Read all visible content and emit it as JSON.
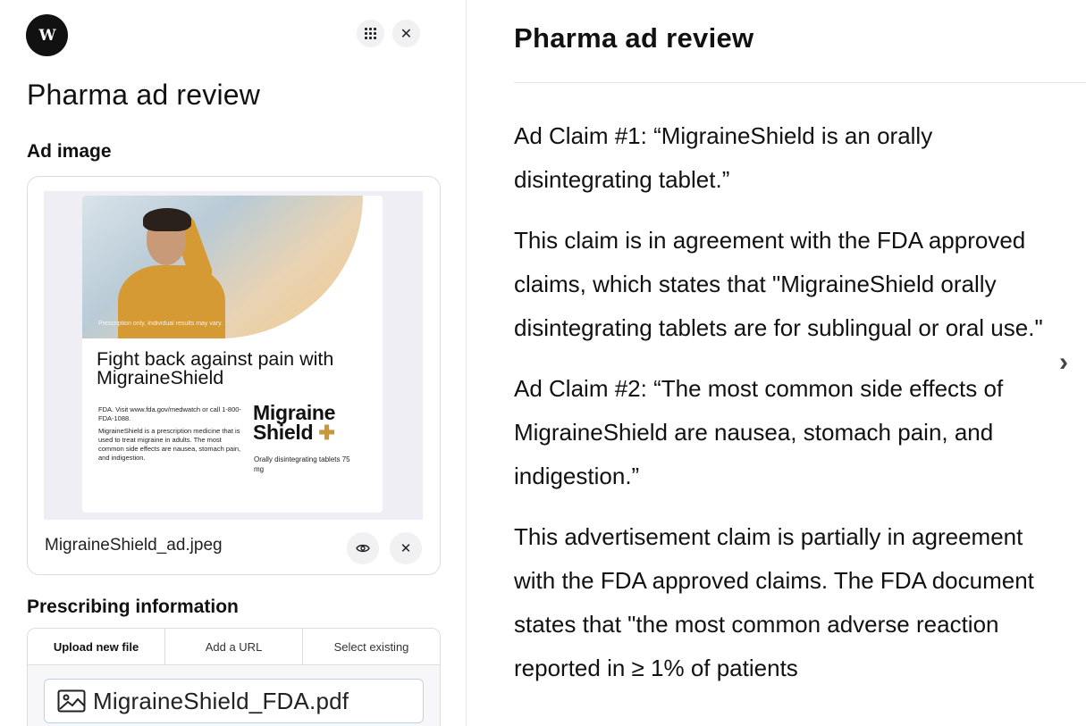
{
  "left_panel": {
    "logo_text": "W",
    "title": "Pharma ad review",
    "ad_image_label": "Ad image",
    "ad": {
      "disclaimer": "Prescription only. Individual results may vary.",
      "headline": "Fight back against pain with MigraineShield",
      "fda_note": "FDA. Visit www.fda.gov/medwatch or call 1-800-FDA-1088.",
      "description": "MigraineShield is a prescription medicine that is used to treat migraine in adults. The most common side effects are nausea, stomach pain, and indigestion.",
      "brand_line1": "Migraine",
      "brand_line2": "Shield",
      "brand_plus": "✚",
      "product_desc": "Orally disintegrating tablets 75 mg"
    },
    "ad_file_name": "MigraineShield_ad.jpeg",
    "prescribing_label": "Prescribing information",
    "tabs": [
      "Upload new file",
      "Add a URL",
      "Select existing"
    ],
    "pdf_file_name": "MigraineShield_FDA.pdf"
  },
  "right_panel": {
    "title": "Pharma ad review",
    "paragraphs": [
      "Ad Claim #1: “MigraineShield is an orally disintegrating tablet.”",
      "This claim is in agreement with the FDA approved claims, which states that \"MigraineShield orally disintegrating tablets are for sublingual or oral use.\"",
      "Ad Claim #2: “The most common side effects of MigraineShield are nausea, stomach pain, and indigestion.”",
      "This advertisement claim is partially in agreement with the FDA approved claims. The FDA document states that \"the most common adverse reaction reported in ≥ 1% of patients"
    ]
  },
  "icons": {
    "grid": "grid-icon",
    "close": "close-icon",
    "eye": "eye-icon",
    "remove": "close-icon",
    "image": "image-icon",
    "chevron": "chevron-right-icon"
  },
  "colors": {
    "accent_border": "#bfcfea",
    "brand_plus": "#c9973a"
  }
}
